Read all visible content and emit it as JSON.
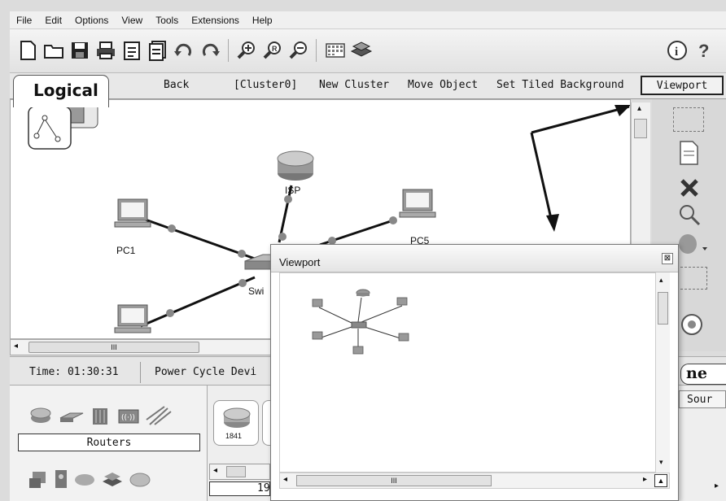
{
  "menu": [
    "File",
    "Edit",
    "Options",
    "View",
    "Tools",
    "Extensions",
    "Help"
  ],
  "toolbar": {
    "icons": [
      "new-icon",
      "open-icon",
      "save-icon",
      "print-icon",
      "activity-wizard-icon",
      "pdu-icon",
      "undo-icon",
      "redo-icon",
      "zoom-in-icon",
      "zoom-reset-icon",
      "zoom-out-icon",
      "palette-icon",
      "custom-device-icon",
      "info-icon",
      "help-icon"
    ]
  },
  "logical_bar": {
    "tab": "Logical",
    "back": "Back",
    "cluster": "[Cluster0]",
    "new_cluster": "New Cluster",
    "move_object": "Move Object",
    "tiled_background": "Set Tiled Background",
    "viewport": "Viewport"
  },
  "workspace": {
    "devices": [
      {
        "name": "ISP",
        "type": "router"
      },
      {
        "name": "PC1",
        "type": "pc"
      },
      {
        "name": "PC5",
        "type": "pc"
      },
      {
        "name": "Swi",
        "type": "switch"
      }
    ]
  },
  "status": {
    "time": "Time: 01:30:31",
    "power_cycle": "Power Cycle Devi"
  },
  "devices_panel": {
    "category_label": "Routers",
    "model": "1841",
    "counter": "19"
  },
  "viewport_window": {
    "title": "Viewport",
    "close": "⊠"
  },
  "right_labels": {
    "mode_label": "ne",
    "source_col": "Sour"
  },
  "hscroll_grip": "III"
}
